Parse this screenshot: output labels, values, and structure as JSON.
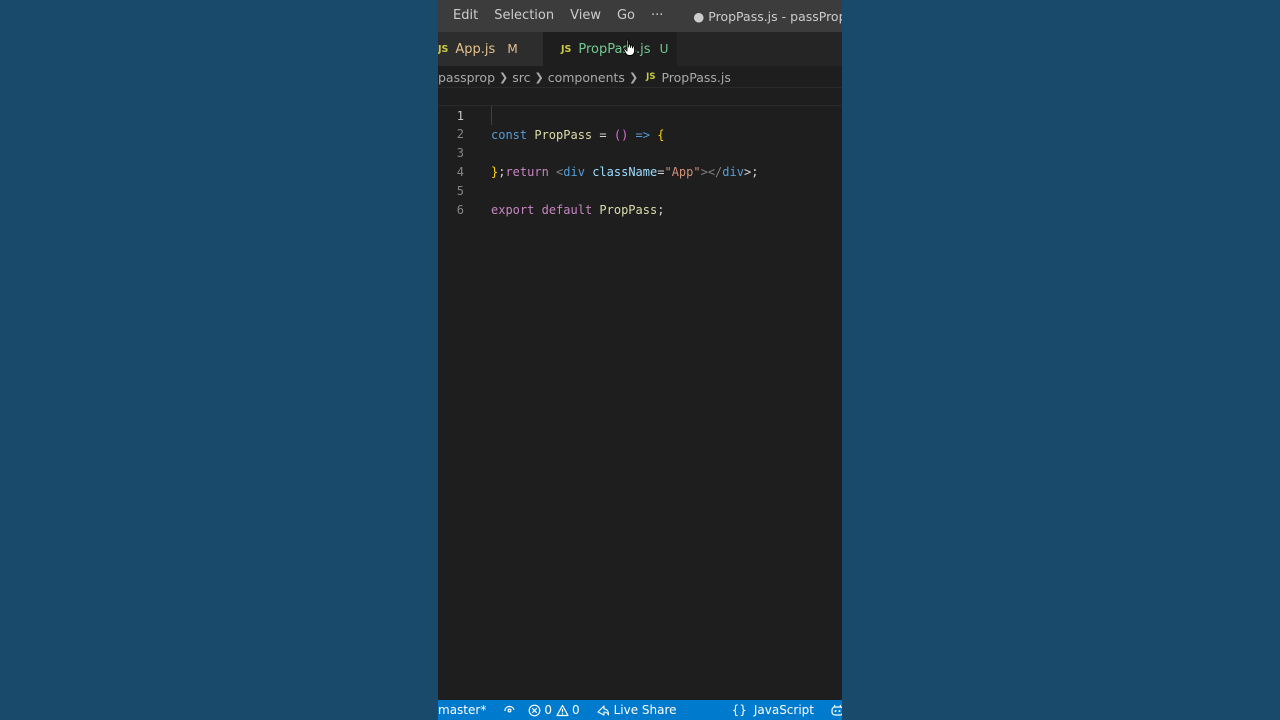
{
  "menubar": {
    "items": [
      "Edit",
      "Selection",
      "View",
      "Go",
      "···"
    ],
    "window_title": "● PropPass.js - passProps - Vis"
  },
  "tabs": [
    {
      "badge": "JS",
      "label": "App.js",
      "status": "M",
      "active": false
    },
    {
      "badge": "JS",
      "label": "PropPass.js",
      "status": "U",
      "active": true,
      "dirty": true
    }
  ],
  "breadcrumb": {
    "items": [
      "passprop",
      "src",
      "components"
    ],
    "file_badge": "JS",
    "file": "PropPass.js"
  },
  "editor": {
    "lines": [
      {
        "num": "1",
        "tokens": [
          "const",
          "PropPass",
          "=",
          "()",
          "=>",
          "{"
        ]
      },
      {
        "num": "2",
        "tokens": [
          "return",
          "<",
          "div",
          "className",
          "=",
          "\"App\"",
          "></",
          "div",
          ">;"
        ]
      },
      {
        "num": "3",
        "tokens": [
          "}",
          ";"
        ]
      },
      {
        "num": "4",
        "tokens": []
      },
      {
        "num": "5",
        "tokens": [
          "export",
          "default",
          "PropPass",
          ";"
        ]
      },
      {
        "num": "6",
        "tokens": []
      }
    ]
  },
  "statusbar": {
    "branch": "master*",
    "errors": "0",
    "warnings": "0",
    "live_share": "Live Share",
    "language_icon": "{}",
    "language": "JavaScript"
  },
  "colors": {
    "accent": "#007acc",
    "background": "#1a4a6b",
    "editor_bg": "#1e1e1e"
  }
}
